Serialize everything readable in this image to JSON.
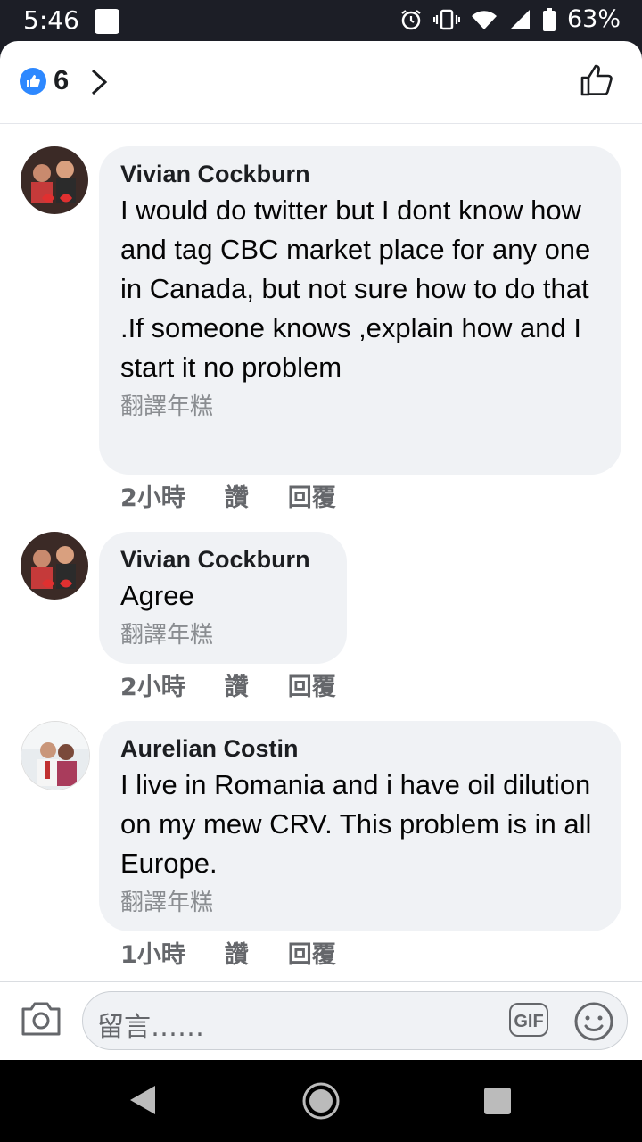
{
  "status_bar": {
    "time": "5:46",
    "battery": "63%"
  },
  "header": {
    "like_count": "6"
  },
  "comments": [
    {
      "author": "Vivian Cockburn",
      "text": "I would do twitter but I dont know how and tag CBC market place for any one in Canada, but not sure how to do that .If someone knows ,explain how and I start it no problem",
      "translate": "翻譯年糕",
      "time": "2小時",
      "like": "讚",
      "reply": "回覆"
    },
    {
      "author": "Vivian Cockburn",
      "text": "Agree",
      "translate": "翻譯年糕",
      "time": "2小時",
      "like": "讚",
      "reply": "回覆"
    },
    {
      "author": "Aurelian Costin",
      "text": "I live in Romania and i have oil dilution on my mew CRV. This problem is in all Europe.",
      "translate": "翻譯年糕",
      "time": "1小時",
      "like": "讚",
      "reply": "回覆"
    }
  ],
  "composer": {
    "placeholder": "留言……",
    "gif_label": "GIF"
  },
  "colors": {
    "like_blue": "#2d88ff",
    "bubble_bg": "#f0f2f5",
    "meta_gray": "#65676b"
  }
}
